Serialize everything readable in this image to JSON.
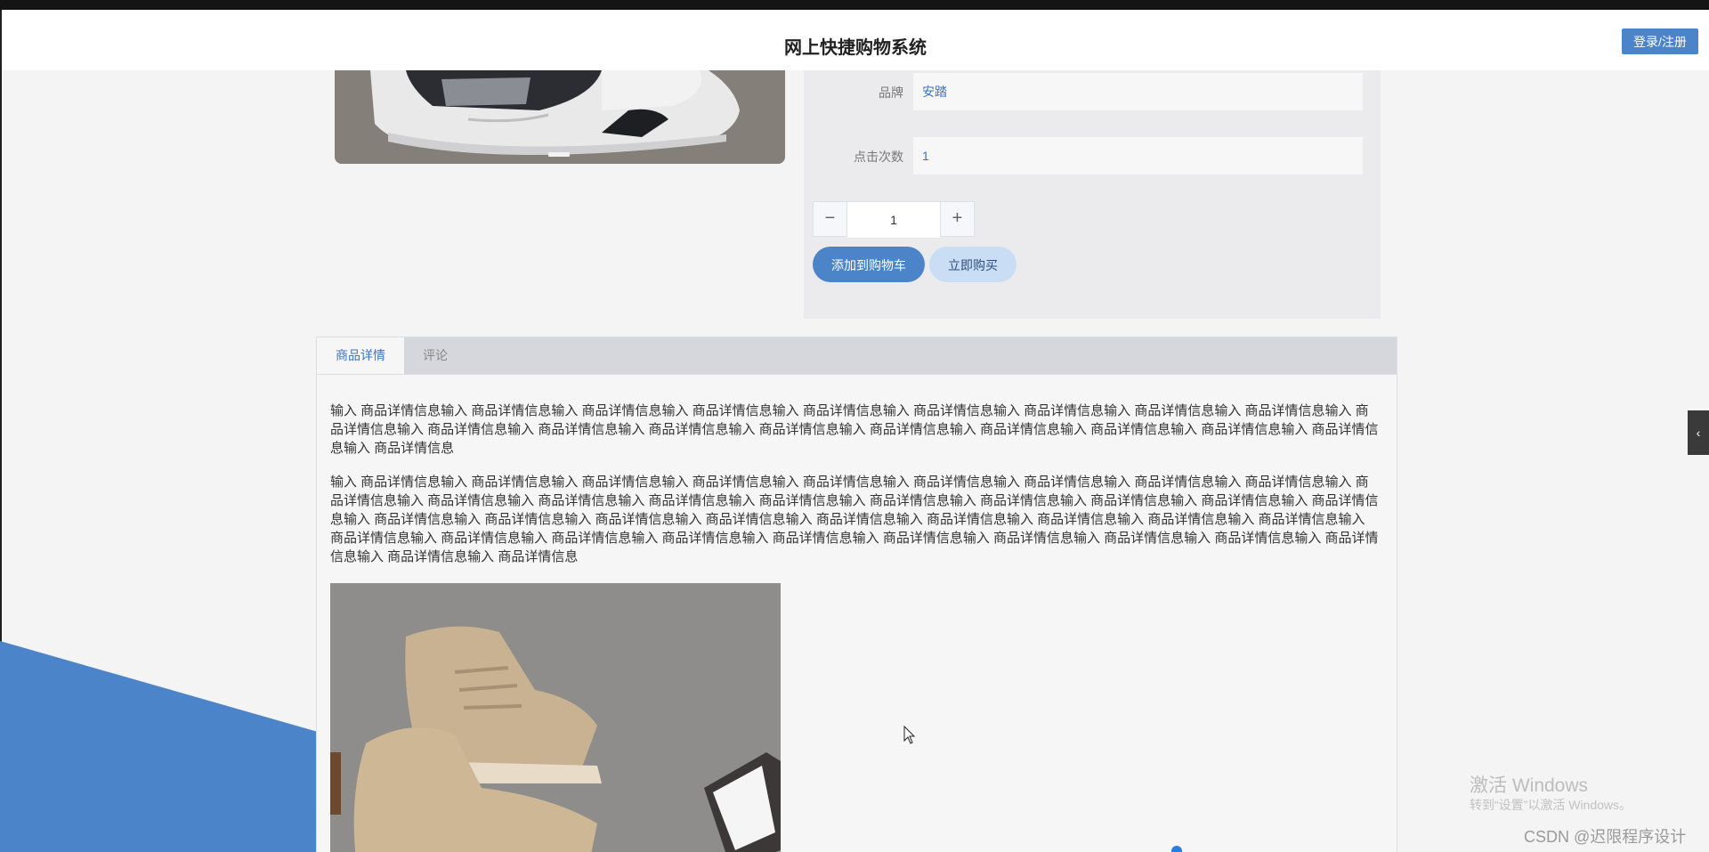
{
  "header": {
    "title": "网上快捷购物系统",
    "login_label": "登录/注册"
  },
  "product": {
    "fields": [
      {
        "label": "品牌",
        "value": "安踏"
      },
      {
        "label": "点击次数",
        "value": "1"
      }
    ],
    "quantity": "1",
    "add_to_cart_label": "添加到购物车",
    "buy_now_label": "立即购买"
  },
  "tabs": [
    {
      "label": "商品详情",
      "active": true
    },
    {
      "label": "评论",
      "active": false
    }
  ],
  "detail": {
    "paragraphs": [
      "输入 商品详情信息输入 商品详情信息输入 商品详情信息输入 商品详情信息输入 商品详情信息输入 商品详情信息输入 商品详情信息输入 商品详情信息输入 商品详情信息输入 商品详情信息输入 商品详情信息输入 商品详情信息输入 商品详情信息输入 商品详情信息输入 商品详情信息输入 商品详情信息输入 商品详情信息输入 商品详情信息输入 商品详情信息输入 商品详情信息",
      "输入 商品详情信息输入 商品详情信息输入 商品详情信息输入 商品详情信息输入 商品详情信息输入 商品详情信息输入 商品详情信息输入 商品详情信息输入 商品详情信息输入 商品详情信息输入 商品详情信息输入 商品详情信息输入 商品详情信息输入 商品详情信息输入 商品详情信息输入 商品详情信息输入 商品详情信息输入 商品详情信息输入 商品详情信息输入 商品详情信息输入 商品详情信息输入 商品详情信息输入 商品详情信息输入 商品详情信息输入 商品详情信息输入 商品详情信息输入 商品详情信息输入 商品详情信息输入 商品详情信息输入 商品详情信息输入 商品详情信息输入 商品详情信息输入 商品详情信息输入 商品详情信息输入 商品详情信息输入 商品详情信息输入 商品详情信息输入 商品详情信息输入 商品详情信息输入 商品详情信息"
    ]
  },
  "overlay": {
    "activate_title": "激活 Windows",
    "activate_sub": "转到“设置”以激活 Windows。",
    "csdn_watermark": "CSDN @迟限程序设计"
  },
  "icons": {
    "minus": "minus-icon",
    "plus": "plus-icon",
    "side_handle": "chevron-left-icon"
  },
  "colors": {
    "accent": "#4b84c8",
    "accent_light": "#c9ddf5",
    "link": "#3b74c0"
  }
}
